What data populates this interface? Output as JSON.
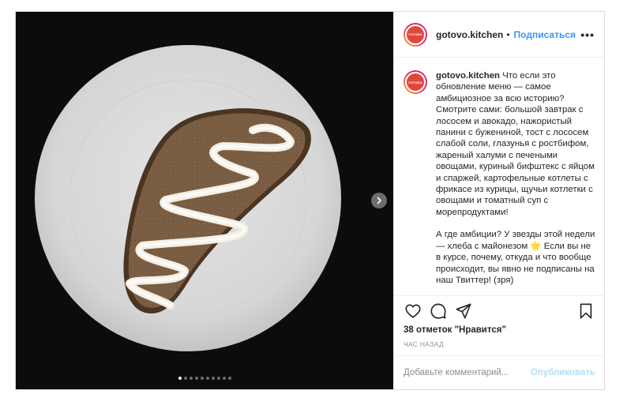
{
  "post": {
    "media": {
      "image_alt": "Slice of rye bread with mayonnaise zigzag on a white plate",
      "carousel": {
        "total": 10,
        "active": 0
      },
      "next_icon": "chevron-right-icon"
    },
    "header": {
      "avatar_text": "ГОТОВО",
      "username": "gotovo.kitchen",
      "separator": "•",
      "follow_label": "Подписаться",
      "more_icon": "more-dots-icon",
      "more_text": "•••"
    },
    "caption": {
      "username": "gotovo.kitchen",
      "paragraph1": "Что если это обновление меню — самое амбициозное за всю историю? Смотрите сами: большой завтрак с лососем и авокадо, нажористый панини с бужениной, тост с лососем слабой соли, глазунья с ростбифом, жареный халуми с печеными овощами, куриный бифштекс с яйцом и спаржей, картофельные котлеты с фрикасе из курицы, щучьи котлетки с овощами и томатный суп с морепродуктами!",
      "paragraph2": "А где амбиции? У звезды этой недели — хлеба с майонезом 🌟 Если вы не в курсе, почему, откуда и что вообще происходит, вы явно не подписаны на наш Твиттер! (зря)"
    },
    "actions": {
      "like_icon": "heart-icon",
      "comment_icon": "comment-icon",
      "share_icon": "share-icon",
      "save_icon": "bookmark-icon"
    },
    "likes_text": "38 отметок \"Нравится\"",
    "time_text": "ЧАС НАЗАД",
    "comment_box": {
      "placeholder": "Добавьте комментарий...",
      "publish_label": "Опубликовать"
    },
    "colors": {
      "accent": "#3897f0",
      "publish_disabled": "#b2dffc",
      "media_bg": "#0c0c0c",
      "plate": "#d9d9d9"
    }
  }
}
